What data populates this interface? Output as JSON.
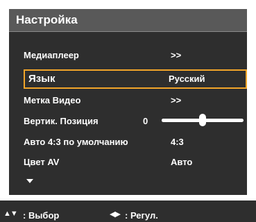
{
  "menu": {
    "title": "Настройка",
    "items": [
      {
        "label": "Медиаплеер",
        "value": ">>"
      },
      {
        "label": "Язык",
        "value": "Русский"
      },
      {
        "label": "Метка Видео",
        "value": ">>"
      },
      {
        "label": "Вертик. Позиция",
        "value": "0"
      },
      {
        "label": "Авто 4:3 по умолчанию",
        "value": "4:3"
      },
      {
        "label": "Цвет AV",
        "value": "Авто"
      }
    ],
    "selected_index": 1,
    "slider_level": 0.5,
    "more_icon": "arrow-down"
  },
  "help": {
    "select_icons": "▲▼",
    "select_label": ": Выбор",
    "adjust_icons": "◀▶",
    "adjust_label": ": Регул."
  },
  "colors": {
    "panel_bg": "#2e2e2e",
    "header_bg": "#595959",
    "selection_border": "#f2a529",
    "text": "#ffffff"
  }
}
